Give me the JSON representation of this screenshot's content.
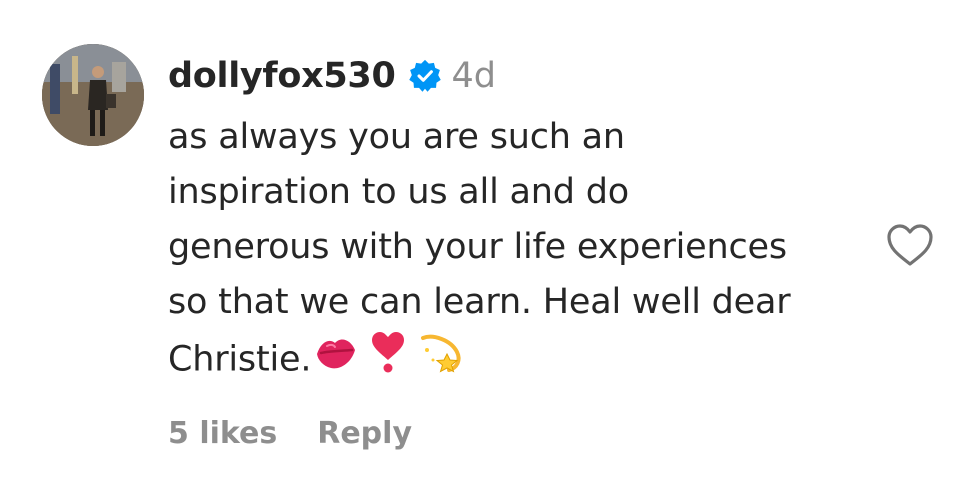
{
  "comment": {
    "username": "dollyfox530",
    "verified": true,
    "timestamp": "4d",
    "text_lines": [
      "as always you are such an",
      "inspiration to us all and do",
      "generous with your life experiences",
      "so that we can learn. Heal well dear",
      "Christie."
    ],
    "emojis": [
      "lips-icon",
      "heart-exclamation-icon",
      "dizzy-star-icon"
    ],
    "likes_label": "5 likes",
    "reply_label": "Reply",
    "like_icon": "heart-outline-icon"
  },
  "colors": {
    "text": "#262626",
    "muted": "#8e8e8e",
    "verified": "#0095f6",
    "emoji_red": "#e0245e"
  }
}
